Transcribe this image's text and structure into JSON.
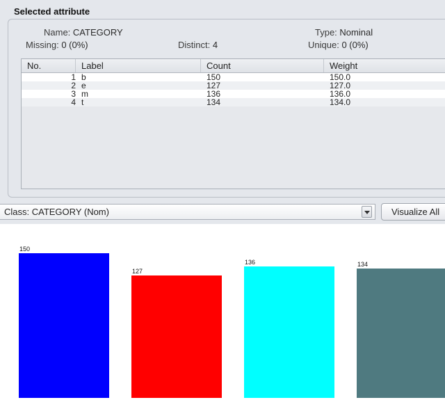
{
  "section_title": "Selected attribute",
  "attribute": {
    "name_label": "Name:",
    "name": "CATEGORY",
    "missing_label": "Missing:",
    "missing": "0 (0%)",
    "distinct_label": "Distinct:",
    "distinct": "4",
    "type_label": "Type:",
    "type": "Nominal",
    "unique_label": "Unique:",
    "unique": "0 (0%)"
  },
  "table": {
    "headers": [
      "No.",
      "Label",
      "Count",
      "Weight"
    ],
    "rows": [
      {
        "no": "1",
        "label": "b",
        "count": "150",
        "weight": "150.0"
      },
      {
        "no": "2",
        "label": "e",
        "count": "127",
        "weight": "127.0"
      },
      {
        "no": "3",
        "label": "m",
        "count": "136",
        "weight": "136.0"
      },
      {
        "no": "4",
        "label": "t",
        "count": "134",
        "weight": "134.0"
      }
    ]
  },
  "class_select": {
    "value": "Class: CATEGORY (Nom)"
  },
  "visualize_label": "Visualize All",
  "colors": {
    "b": "#0000ff",
    "e": "#ff0000",
    "m": "#00ffff",
    "t": "#4f7a80"
  },
  "chart_data": {
    "type": "bar",
    "categories": [
      "b",
      "e",
      "m",
      "t"
    ],
    "values": [
      150,
      127,
      136,
      134
    ],
    "data_labels": [
      "150",
      "127",
      "136",
      "134"
    ],
    "colors": [
      "#0000ff",
      "#ff0000",
      "#00ffff",
      "#4f7a80"
    ],
    "title": "",
    "xlabel": "",
    "ylabel": "",
    "ylim": [
      0,
      150
    ]
  }
}
